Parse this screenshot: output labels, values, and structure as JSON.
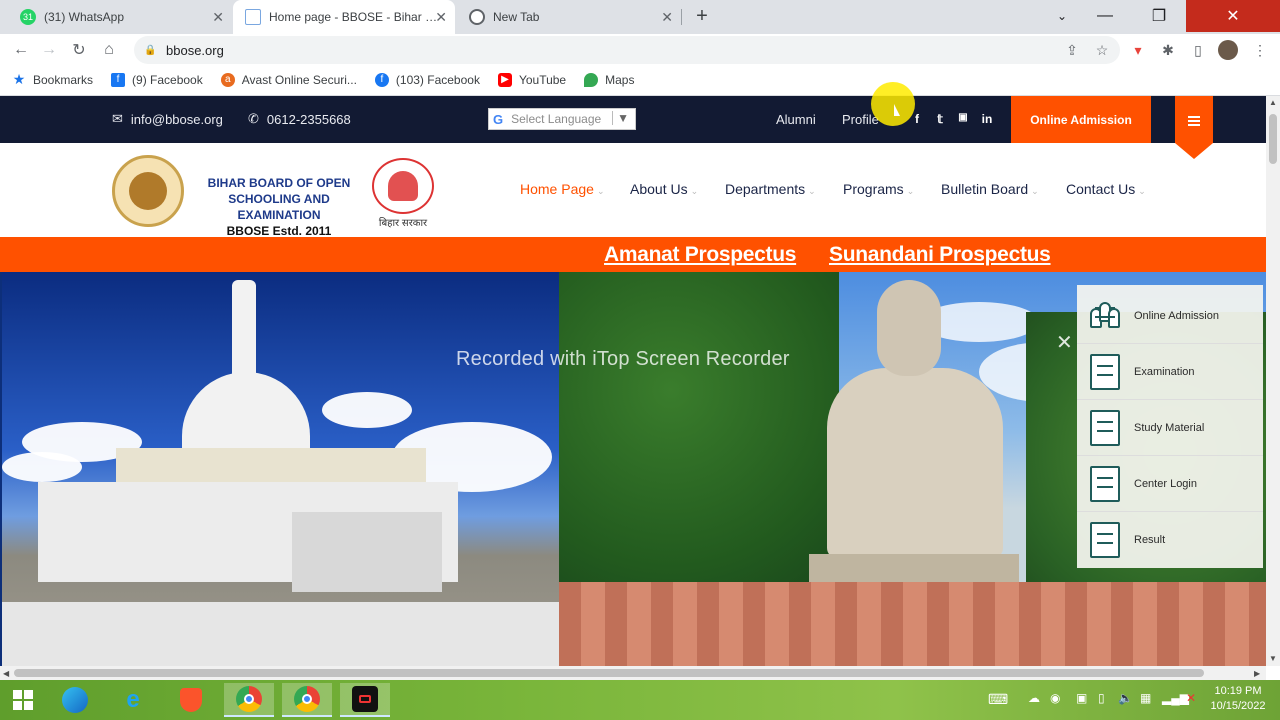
{
  "browser": {
    "tabs": [
      {
        "title": "(31) WhatsApp",
        "favicon": "whatsapp-icon",
        "active": false
      },
      {
        "title": "Home page - BBOSE - Bihar Boa",
        "favicon": "page-icon",
        "active": true
      },
      {
        "title": "New Tab",
        "favicon": "google-icon",
        "active": false
      }
    ],
    "url": "bbose.org",
    "bookmarks": [
      {
        "label": "Bookmarks",
        "icon": "star-icon",
        "color": "#1a73e8"
      },
      {
        "label": "(9) Facebook",
        "icon": "facebook-icon",
        "color": "#1877f2"
      },
      {
        "label": "Avast Online Securi...",
        "icon": "avast-icon",
        "color": "#e86b1f"
      },
      {
        "label": "(103) Facebook",
        "icon": "facebook-icon",
        "color": "#1877f2"
      },
      {
        "label": "YouTube",
        "icon": "youtube-icon",
        "color": "#ff0000"
      },
      {
        "label": "Maps",
        "icon": "maps-icon",
        "color": "#34a853"
      }
    ]
  },
  "site": {
    "topbar": {
      "email": "info@bbose.org",
      "phone": "0612-2355668",
      "language_placeholder": "Select Language",
      "links": [
        "Alumni",
        "Profile"
      ],
      "social": [
        "f",
        "twitter",
        "youtube",
        "in"
      ],
      "admission_button": "Online Admission"
    },
    "brand": {
      "line1": "BIHAR BOARD OF OPEN",
      "line2": "SCHOOLING AND EXAMINATION",
      "line3": "BBOSE Estd. 2011",
      "seal_caption": "बिहार सरकार"
    },
    "nav": [
      "Home Page",
      "About Us",
      "Departments",
      "Programs",
      "Bulletin Board",
      "Contact Us"
    ],
    "prospectus": [
      "Amanat Prospectus",
      "Sunandani Prospectus"
    ],
    "quick_links": [
      "Online Admission",
      "Examination",
      "Study Material",
      "Center Login",
      "Result"
    ],
    "watermark": "Recorded with iTop Screen Recorder",
    "accent_color": "#ff5100",
    "topbar_color": "#121a33"
  },
  "taskbar": {
    "time": "10:19 PM",
    "date": "10/15/2022"
  }
}
